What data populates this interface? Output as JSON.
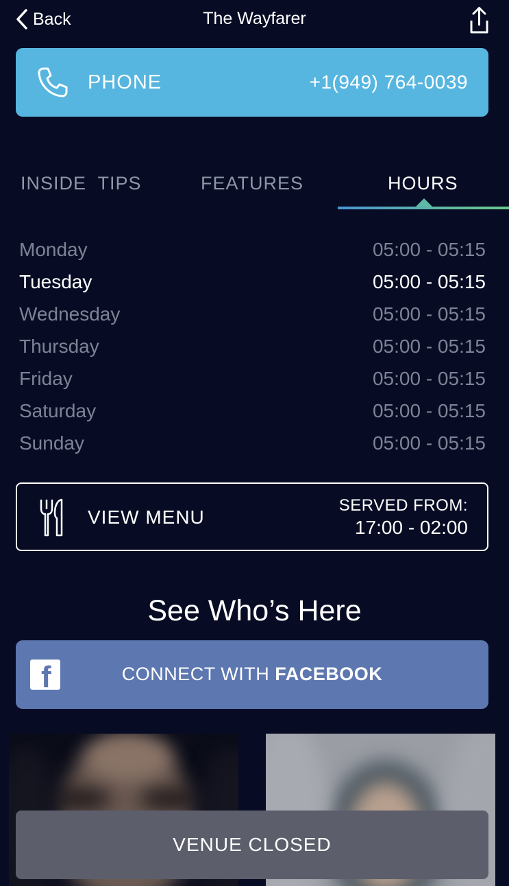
{
  "nav": {
    "back_label": "Back",
    "title": "The Wayfarer"
  },
  "phone": {
    "label": "PHONE",
    "number": "+1(949) 764-0039",
    "color": "#56b6df"
  },
  "tabs": [
    {
      "label": "INSIDE  TIPS",
      "active": false
    },
    {
      "label": "FEATURES",
      "active": false
    },
    {
      "label": "HOURS",
      "active": true
    }
  ],
  "hours": [
    {
      "day": "Monday",
      "time": "05:00 - 05:15",
      "today": false
    },
    {
      "day": "Tuesday",
      "time": "05:00 - 05:15",
      "today": true
    },
    {
      "day": "Wednesday",
      "time": "05:00 - 05:15",
      "today": false
    },
    {
      "day": "Thursday",
      "time": "05:00 - 05:15",
      "today": false
    },
    {
      "day": "Friday",
      "time": "05:00 - 05:15",
      "today": false
    },
    {
      "day": "Saturday",
      "time": "05:00 - 05:15",
      "today": false
    },
    {
      "day": "Sunday",
      "time": "05:00 - 05:15",
      "today": false
    }
  ],
  "menu": {
    "label": "VIEW MENU",
    "served_label": "SERVED FROM:",
    "served_time": "17:00 - 02:00",
    "icon": "fork-knife-icon"
  },
  "social": {
    "title": "See Who’s Here",
    "connect_prefix": "CONNECT WITH ",
    "connect_brand": "FACEBOOK",
    "color": "#5d77b0"
  },
  "footer": {
    "status": "VENUE CLOSED"
  },
  "colors": {
    "background": "#070c24",
    "tab_accent": "#5fb8a3",
    "inactive_text": "#7d8394"
  }
}
